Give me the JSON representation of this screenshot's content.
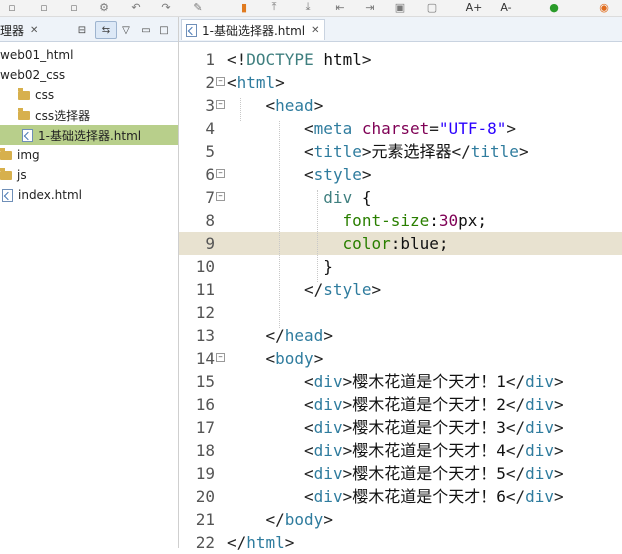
{
  "toolbar": {
    "icons": [
      "save-icon",
      "save-all-icon",
      "build-icon",
      "undo-icon",
      "redo-icon",
      "quick-assist-icon",
      "bookmark-icon",
      "prev-annotation-icon",
      "next-annotation-icon",
      "prev-edit-icon",
      "next-edit-icon",
      "copy-icon",
      "hide-icon",
      "font-increase-icon",
      "font-decrease-icon",
      "run-icon",
      "browser-icon"
    ],
    "font_increase": "A+",
    "font_decrease": "A-"
  },
  "left_panel": {
    "tab_label": "理器",
    "tree": [
      {
        "label": "web01_html",
        "type": "project"
      },
      {
        "label": "web02_css",
        "type": "project"
      },
      {
        "label": "css",
        "type": "folder"
      },
      {
        "label": "css选择器",
        "type": "folder"
      },
      {
        "label": "1-基础选择器.html",
        "type": "file",
        "selected": true
      },
      {
        "label": "img",
        "type": "folder"
      },
      {
        "label": "js",
        "type": "folder"
      },
      {
        "label": "index.html",
        "type": "file"
      }
    ]
  },
  "editor": {
    "tab_label": "1-基础选择器.html",
    "current_line": 9,
    "lines": [
      {
        "n": "1",
        "fold": "",
        "indent": 0,
        "tokens": [
          [
            "br",
            "<!"
          ],
          [
            "tn",
            "DOCTYPE"
          ],
          [
            "pl",
            " html"
          ],
          [
            "br",
            ">"
          ]
        ]
      },
      {
        "n": "2",
        "fold": "−",
        "indent": 0,
        "tokens": [
          [
            "br",
            "<"
          ],
          [
            "tg",
            "html"
          ],
          [
            "br",
            ">"
          ]
        ]
      },
      {
        "n": "3",
        "fold": "−",
        "indent": 2,
        "tokens": [
          [
            "br",
            "<"
          ],
          [
            "tg",
            "head"
          ],
          [
            "br",
            ">"
          ]
        ]
      },
      {
        "n": "4",
        "fold": "",
        "indent": 4,
        "tokens": [
          [
            "br",
            "<"
          ],
          [
            "tg",
            "meta"
          ],
          [
            "pl",
            " "
          ],
          [
            "at",
            "charset"
          ],
          [
            "br",
            "="
          ],
          [
            "av",
            "\"UTF-8\""
          ],
          [
            "br",
            ">"
          ]
        ]
      },
      {
        "n": "5",
        "fold": "",
        "indent": 4,
        "tokens": [
          [
            "br",
            "<"
          ],
          [
            "tg",
            "title"
          ],
          [
            "br",
            ">"
          ],
          [
            "pl",
            "元素选择器"
          ],
          [
            "br",
            "</"
          ],
          [
            "tg",
            "title"
          ],
          [
            "br",
            ">"
          ]
        ]
      },
      {
        "n": "6",
        "fold": "−",
        "indent": 4,
        "tokens": [
          [
            "br",
            "<"
          ],
          [
            "tg",
            "style"
          ],
          [
            "br",
            ">"
          ]
        ]
      },
      {
        "n": "7",
        "fold": "−",
        "indent": 5,
        "tokens": [
          [
            "css-sel",
            "div"
          ],
          [
            "pl",
            " {"
          ]
        ]
      },
      {
        "n": "8",
        "fold": "",
        "indent": 6,
        "tokens": [
          [
            "css-prop",
            "font-size"
          ],
          [
            "pl",
            ":"
          ],
          [
            "css-num",
            "30"
          ],
          [
            "css-val",
            "px;"
          ]
        ]
      },
      {
        "n": "9",
        "fold": "",
        "indent": 6,
        "tokens": [
          [
            "css-prop",
            "color"
          ],
          [
            "pl",
            ":"
          ],
          [
            "css-val",
            "blue;"
          ]
        ]
      },
      {
        "n": "10",
        "fold": "",
        "indent": 5,
        "tokens": [
          [
            "pl",
            "}"
          ]
        ]
      },
      {
        "n": "11",
        "fold": "",
        "indent": 4,
        "tokens": [
          [
            "br",
            "</"
          ],
          [
            "tg",
            "style"
          ],
          [
            "br",
            ">"
          ]
        ]
      },
      {
        "n": "12",
        "fold": "",
        "indent": 0,
        "tokens": []
      },
      {
        "n": "13",
        "fold": "",
        "indent": 2,
        "tokens": [
          [
            "br",
            "</"
          ],
          [
            "tg",
            "head"
          ],
          [
            "br",
            ">"
          ]
        ]
      },
      {
        "n": "14",
        "fold": "−",
        "indent": 2,
        "tokens": [
          [
            "br",
            "<"
          ],
          [
            "tg",
            "body"
          ],
          [
            "br",
            ">"
          ]
        ]
      },
      {
        "n": "15",
        "fold": "",
        "indent": 4,
        "tokens": [
          [
            "br",
            "<"
          ],
          [
            "tg",
            "div"
          ],
          [
            "br",
            ">"
          ],
          [
            "pl",
            "樱木花道是个天才！1"
          ],
          [
            "br",
            "</"
          ],
          [
            "tg",
            "div"
          ],
          [
            "br",
            ">"
          ]
        ]
      },
      {
        "n": "16",
        "fold": "",
        "indent": 4,
        "tokens": [
          [
            "br",
            "<"
          ],
          [
            "tg",
            "div"
          ],
          [
            "br",
            ">"
          ],
          [
            "pl",
            "樱木花道是个天才！2"
          ],
          [
            "br",
            "</"
          ],
          [
            "tg",
            "div"
          ],
          [
            "br",
            ">"
          ]
        ]
      },
      {
        "n": "17",
        "fold": "",
        "indent": 4,
        "tokens": [
          [
            "br",
            "<"
          ],
          [
            "tg",
            "div"
          ],
          [
            "br",
            ">"
          ],
          [
            "pl",
            "樱木花道是个天才！3"
          ],
          [
            "br",
            "</"
          ],
          [
            "tg",
            "div"
          ],
          [
            "br",
            ">"
          ]
        ]
      },
      {
        "n": "18",
        "fold": "",
        "indent": 4,
        "tokens": [
          [
            "br",
            "<"
          ],
          [
            "tg",
            "div"
          ],
          [
            "br",
            ">"
          ],
          [
            "pl",
            "樱木花道是个天才！4"
          ],
          [
            "br",
            "</"
          ],
          [
            "tg",
            "div"
          ],
          [
            "br",
            ">"
          ]
        ]
      },
      {
        "n": "19",
        "fold": "",
        "indent": 4,
        "tokens": [
          [
            "br",
            "<"
          ],
          [
            "tg",
            "div"
          ],
          [
            "br",
            ">"
          ],
          [
            "pl",
            "樱木花道是个天才！5"
          ],
          [
            "br",
            "</"
          ],
          [
            "tg",
            "div"
          ],
          [
            "br",
            ">"
          ]
        ]
      },
      {
        "n": "20",
        "fold": "",
        "indent": 4,
        "tokens": [
          [
            "br",
            "<"
          ],
          [
            "tg",
            "div"
          ],
          [
            "br",
            ">"
          ],
          [
            "pl",
            "樱木花道是个天才！6"
          ],
          [
            "br",
            "</"
          ],
          [
            "tg",
            "div"
          ],
          [
            "br",
            ">"
          ]
        ]
      },
      {
        "n": "21",
        "fold": "",
        "indent": 2,
        "tokens": [
          [
            "br",
            "</"
          ],
          [
            "tg",
            "body"
          ],
          [
            "br",
            ">"
          ]
        ]
      },
      {
        "n": "22",
        "fold": "",
        "indent": 0,
        "tokens": [
          [
            "br",
            "</"
          ],
          [
            "tg",
            "html"
          ],
          [
            "br",
            ">"
          ]
        ]
      }
    ]
  },
  "colors": {
    "selection": "#b8cf8b",
    "current_line": "#e8e2d0",
    "tag": "#2f7c9e",
    "attr": "#7f0055",
    "string": "#2a00ff",
    "css_property": "#2a7f00"
  }
}
